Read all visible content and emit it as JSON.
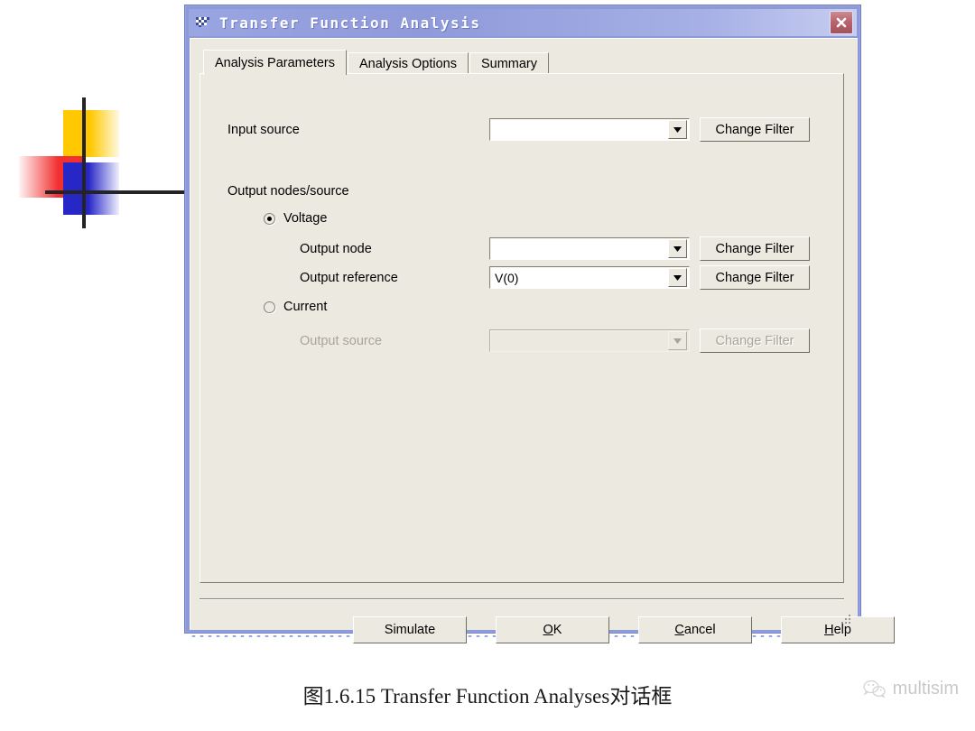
{
  "window": {
    "title": "Transfer Function Analysis",
    "icon": "checkered-flag-icon",
    "close_label": "close-icon",
    "frame_color": "#8e9ad8",
    "titlebar_gradient_from": "#9aa6e2",
    "titlebar_gradient_to": "#c6cdf0",
    "client_bg": "#ece9e0"
  },
  "tabs": [
    {
      "label": "Analysis Parameters",
      "active": true
    },
    {
      "label": "Analysis Options",
      "active": false
    },
    {
      "label": "Summary",
      "active": false
    }
  ],
  "form": {
    "input_source": {
      "label": "Input source",
      "value": "",
      "button_label": "Change Filter",
      "enabled": true
    },
    "group_label": "Output nodes/source",
    "voltage": {
      "label": "Voltage",
      "selected": true,
      "output_node": {
        "label": "Output node",
        "value": "",
        "button_label": "Change Filter",
        "enabled": true
      },
      "output_reference": {
        "label": "Output reference",
        "value": "V(0)",
        "button_label": "Change Filter",
        "enabled": true
      }
    },
    "current": {
      "label": "Current",
      "selected": false,
      "output_source": {
        "label": "Output source",
        "value": "",
        "button_label": "Change Filter",
        "enabled": false
      }
    }
  },
  "footer": {
    "simulate": {
      "label": "Simulate",
      "accel": ""
    },
    "ok": {
      "pre": "",
      "accel": "O",
      "post": "K"
    },
    "cancel": {
      "pre": "",
      "accel": "C",
      "post": "ancel"
    },
    "help": {
      "pre": "",
      "accel": "H",
      "post": "elp"
    }
  },
  "caption": "图1.6.15  Transfer Function Analyses对话框",
  "watermark": {
    "text": "multisim",
    "icon": "wechat-icon"
  }
}
